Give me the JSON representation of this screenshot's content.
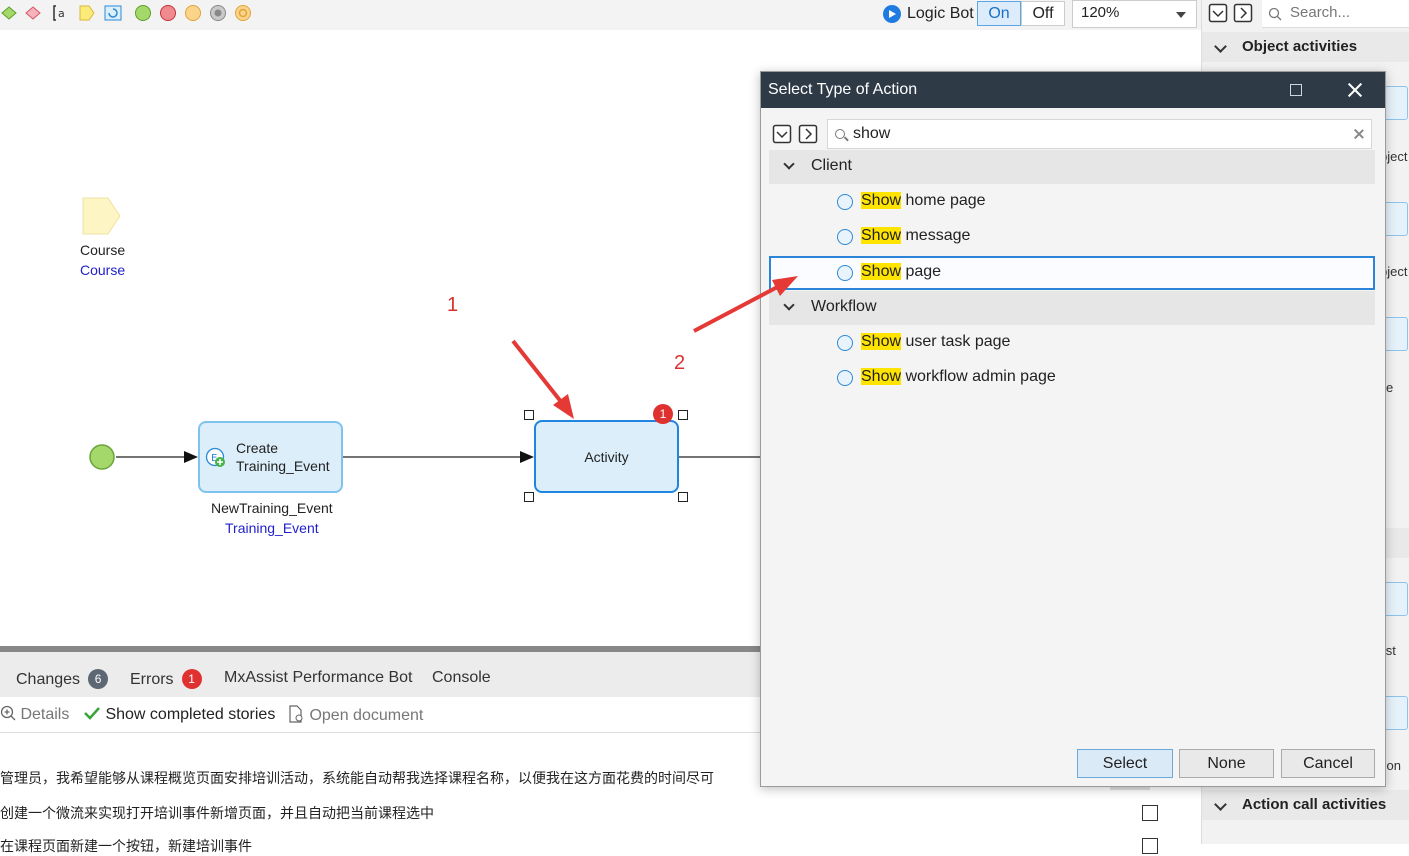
{
  "toolbar": {
    "logic_bot_label": "Logic Bot",
    "toggle_on": "On",
    "toggle_off": "Off",
    "zoom_value": "120%",
    "colors": {
      "accent": "#1f7be0"
    }
  },
  "right_panel": {
    "search_placeholder": "Search...",
    "object_activities": "Object activities",
    "action_call_activities": "Action call activities",
    "truncated_labels": [
      "bject",
      "bject",
      "e",
      "list",
      "tion"
    ]
  },
  "canvas": {
    "course_label": "Course",
    "course_entity": "Course",
    "create_node_label": "Create Training_Event",
    "create_node_var": "NewTraining_Event",
    "create_node_entity": "Training_Event",
    "activity_label": "Activity",
    "activity_error_count": "1",
    "annotation_1": "1",
    "annotation_2": "2"
  },
  "bottom_panel": {
    "tabs": [
      {
        "label": "Changes",
        "count": "6"
      },
      {
        "label": "Errors",
        "count": "1"
      },
      {
        "label": "MxAssist Performance Bot"
      },
      {
        "label": "Console"
      }
    ],
    "tools": {
      "details": "Details",
      "show_completed": "Show completed stories",
      "open_document": "Open document"
    },
    "stories": [
      "管理员，我希望能够从课程概览页面安排培训活动，系统能自动帮我选择课程名称，以便我在这方面花费的时间尽可",
      "创建一个微流来实现打开培训事件新增页面，并且自动把当前课程选中",
      "在课程页面新建一个按钮，新建培训事件"
    ]
  },
  "dialog": {
    "title": "Select Type of Action",
    "search_value": "show",
    "groups": [
      {
        "label": "Client",
        "items": [
          {
            "highlight": "Show",
            "rest": " home page",
            "selected": false
          },
          {
            "highlight": "Show",
            "rest": " message",
            "selected": false
          },
          {
            "highlight": "Show",
            "rest": " page",
            "selected": true
          }
        ]
      },
      {
        "label": "Workflow",
        "items": [
          {
            "highlight": "Show",
            "rest": " user task page",
            "selected": false
          },
          {
            "highlight": "Show",
            "rest": " workflow admin page",
            "selected": false
          }
        ]
      }
    ],
    "buttons": {
      "select": "Select",
      "none": "None",
      "cancel": "Cancel"
    }
  }
}
